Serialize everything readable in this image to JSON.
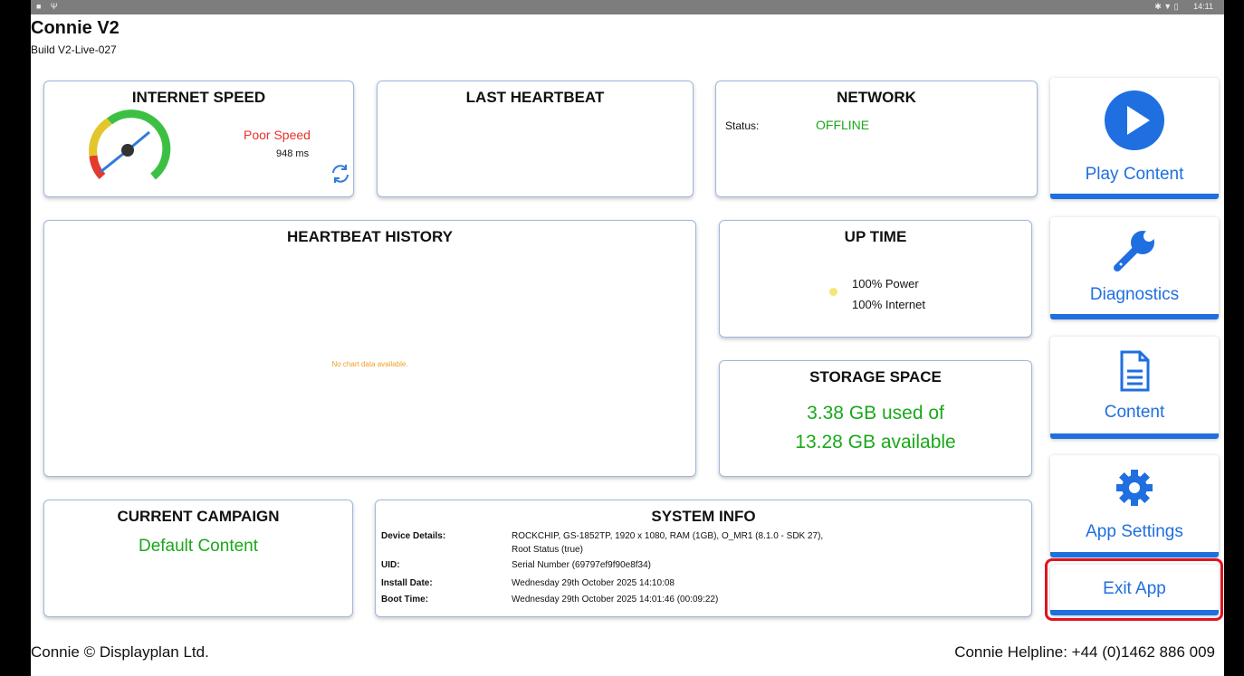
{
  "statusbar": {
    "left_icons": "■ Ψ",
    "time": "14:11",
    "right_icons": "✱ ▼ ▯"
  },
  "app": {
    "title": "Connie V2",
    "build": "Build V2-Live-027"
  },
  "internet_speed": {
    "title": "INTERNET SPEED",
    "quality": "Poor Speed",
    "latency": "948 ms",
    "gauge_needle_fraction": 0.7,
    "quality_color": "#e8322a",
    "refresh_icon": "refresh-icon"
  },
  "last_heartbeat": {
    "title": "LAST HEARTBEAT"
  },
  "network": {
    "title": "NETWORK",
    "status_label": "Status:",
    "status_value": "OFFLINE",
    "status_color": "#1aa81a"
  },
  "heartbeat_history": {
    "title": "HEARTBEAT HISTORY",
    "empty_message": "No chart data available.",
    "empty_color": "#f0a020"
  },
  "up_time": {
    "title": "UP TIME",
    "power": "100% Power",
    "internet": "100% Internet",
    "dot_color": "#f5e67a"
  },
  "storage": {
    "title": "STORAGE SPACE",
    "used": "3.38 GB used of",
    "available": "13.28 GB available",
    "color": "#1aa81a"
  },
  "current_campaign": {
    "title": "CURRENT CAMPAIGN",
    "value": "Default Content",
    "color": "#1aa81a"
  },
  "system_info": {
    "title": "SYSTEM INFO",
    "rows": [
      {
        "label": "Device Details:",
        "value": "ROCKCHIP, GS-1852TP, 1920 x 1080, RAM (1GB), O_MR1 (8.1.0 - SDK 27),",
        "value2": "Root Status (true)"
      },
      {
        "label": "UID:",
        "value": "Serial Number (69797ef9f90e8f34)"
      },
      {
        "label": "Install Date:",
        "value": "Wednesday 29th October 2025 14:10:08"
      },
      {
        "label": "Boot Time:",
        "value": "Wednesday 29th October 2025 14:01:46 (00:09:22)"
      }
    ]
  },
  "nav": {
    "play_content": "Play Content",
    "diagnostics": "Diagnostics",
    "content": "Content",
    "app_settings": "App Settings",
    "exit_app": "Exit App",
    "accent": "#1f6fe0",
    "exit_highlight": "#e0141e"
  },
  "footer": {
    "left": "Connie © Displayplan Ltd.",
    "right": "Connie Helpline: +44 (0)1462 886 009"
  }
}
